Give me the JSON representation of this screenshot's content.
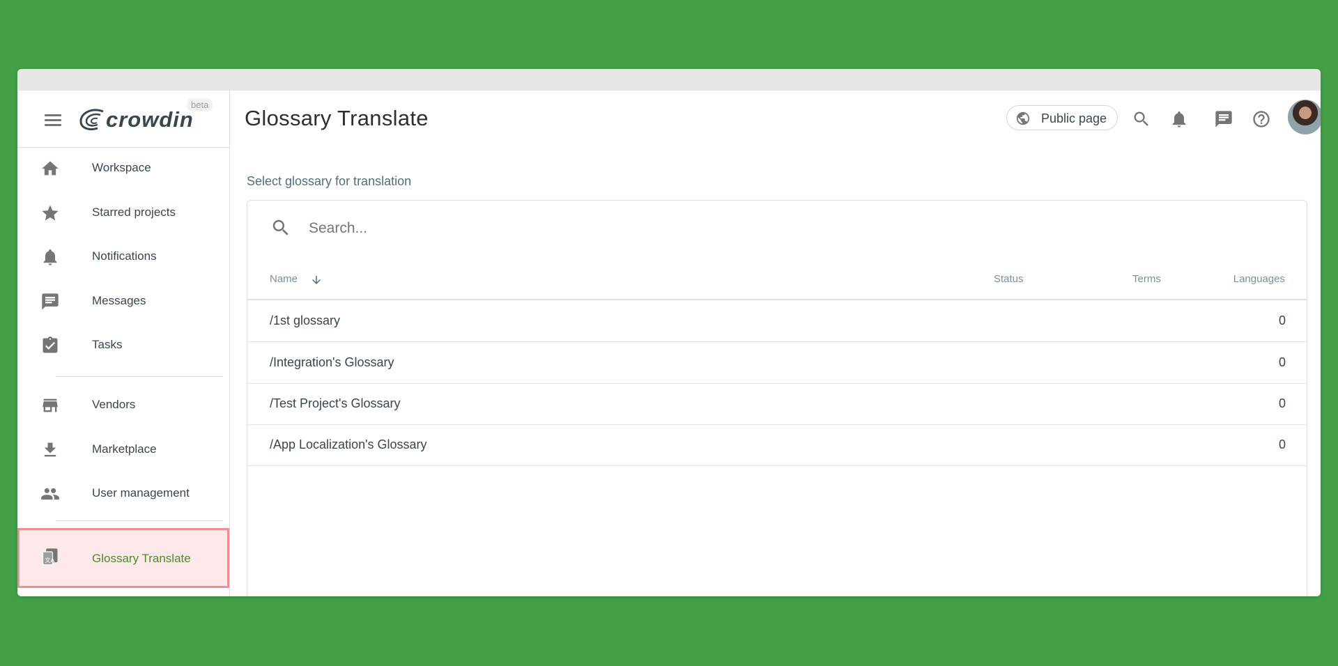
{
  "app": {
    "logo_text": "crowdin",
    "beta_label": "beta"
  },
  "sidebar": {
    "items": [
      {
        "label": "Workspace",
        "icon": "home-icon"
      },
      {
        "label": "Starred projects",
        "icon": "star-icon"
      },
      {
        "label": "Notifications",
        "icon": "bell-icon"
      },
      {
        "label": "Messages",
        "icon": "message-icon"
      },
      {
        "label": "Tasks",
        "icon": "task-icon"
      },
      {
        "label": "Vendors",
        "icon": "store-icon"
      },
      {
        "label": "Marketplace",
        "icon": "download-icon"
      },
      {
        "label": "User management",
        "icon": "people-icon"
      },
      {
        "label": "Glossary Translate",
        "icon": "glossary-translate-icon",
        "active": true
      }
    ]
  },
  "header": {
    "title": "Glossary Translate",
    "public_page_label": "Public page"
  },
  "main": {
    "subtitle": "Select glossary for translation",
    "search_placeholder": "Search...",
    "columns": {
      "name": "Name",
      "status": "Status",
      "terms": "Terms",
      "languages": "Languages"
    },
    "rows": [
      {
        "name": "/1st glossary",
        "languages": "0"
      },
      {
        "name": "/Integration's Glossary",
        "languages": "0"
      },
      {
        "name": "/Test Project's Glossary",
        "languages": "0"
      },
      {
        "name": "/App Localization's Glossary",
        "languages": "0"
      }
    ]
  },
  "colors": {
    "background": "#43a047",
    "active_item_bg": "#fde9ea",
    "active_item_border": "#ef8f93",
    "active_item_text": "#4c8b2e"
  }
}
